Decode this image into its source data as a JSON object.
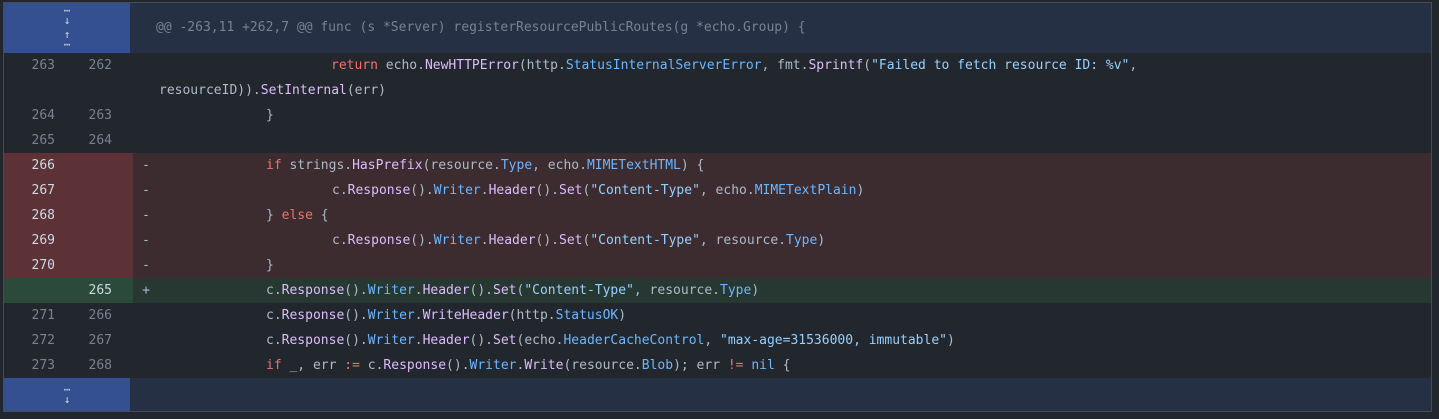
{
  "hunk_top": {
    "header": "@@ -263,11 +262,7 @@ func (s *Server) registerResourcePublicRoutes(g *echo.Group) {",
    "expand_down_icon": "expand-down-icon",
    "expand_up_icon": "expand-up-icon"
  },
  "hunk_bottom": {
    "expand_down_icon": "expand-down-icon"
  },
  "lines": [
    {
      "old": "263",
      "new": "262",
      "sign": "",
      "type": "ctx"
    },
    {
      "old": "264",
      "new": "263",
      "sign": "",
      "type": "ctx"
    },
    {
      "old": "265",
      "new": "264",
      "sign": "",
      "type": "ctx"
    },
    {
      "old": "266",
      "new": "",
      "sign": "-",
      "type": "del"
    },
    {
      "old": "267",
      "new": "",
      "sign": "-",
      "type": "del"
    },
    {
      "old": "268",
      "new": "",
      "sign": "-",
      "type": "del"
    },
    {
      "old": "269",
      "new": "",
      "sign": "-",
      "type": "del"
    },
    {
      "old": "270",
      "new": "",
      "sign": "-",
      "type": "del"
    },
    {
      "old": "",
      "new": "265",
      "sign": "+",
      "type": "add"
    },
    {
      "old": "271",
      "new": "266",
      "sign": "",
      "type": "ctx"
    },
    {
      "old": "272",
      "new": "267",
      "sign": "",
      "type": "ctx"
    },
    {
      "old": "273",
      "new": "268",
      "sign": "",
      "type": "ctx"
    }
  ],
  "code": {
    "l1a": "return echo.NewHTTPError(http.StatusInternalServerError, fmt.Sprintf(\"Failed to fetch resource ID: %v\",",
    "l1b": "resourceID)).SetInternal(err)",
    "l2": "}",
    "l3": "",
    "l4": "if strings.HasPrefix(resource.Type, echo.MIMETextHTML) {",
    "l5": "c.Response().Writer.Header().Set(\"Content-Type\", echo.MIMETextPlain)",
    "l6": "} else {",
    "l7": "c.Response().Writer.Header().Set(\"Content-Type\", resource.Type)",
    "l8": "}",
    "l9": "c.Response().Writer.Header().Set(\"Content-Type\", resource.Type)",
    "l10": "c.Response().Writer.WriteHeader(http.StatusOK)",
    "l11": "c.Response().Writer.Header().Set(echo.HeaderCacheControl, \"max-age=31536000, immutable\")",
    "l12": "if _, err := c.Response().Writer.Write(resource.Blob); err != nil {"
  }
}
